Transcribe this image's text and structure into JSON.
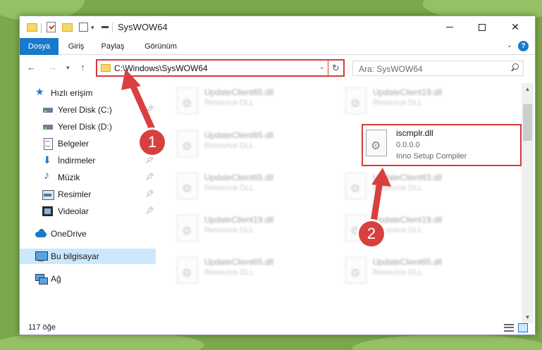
{
  "window": {
    "title": "SysWOW64",
    "minimize_glyph": "",
    "close_glyph": "✕"
  },
  "ribbon": {
    "tabs": [
      "Dosya",
      "Giriş",
      "Paylaş",
      "Görünüm"
    ],
    "help_glyph": "?"
  },
  "address_bar": {
    "path": "C:\\Windows\\SysWOW64",
    "search_placeholder": "Ara: SysWOW64"
  },
  "sidebar": {
    "items": [
      {
        "label": "Hızlı erişim",
        "icon": "star-icon",
        "pinned": false
      },
      {
        "label": "Yerel Disk (C:)",
        "icon": "disk-icon",
        "pinned": true
      },
      {
        "label": "Yerel Disk (D:)",
        "icon": "disk-icon",
        "pinned": true
      },
      {
        "label": "Belgeler",
        "icon": "document-icon",
        "pinned": true
      },
      {
        "label": "İndirmeler",
        "icon": "download-icon",
        "pinned": true
      },
      {
        "label": "Müzik",
        "icon": "music-icon",
        "pinned": true
      },
      {
        "label": "Resimler",
        "icon": "pictures-icon",
        "pinned": true
      },
      {
        "label": "Videolar",
        "icon": "video-icon",
        "pinned": true
      },
      {
        "label": "OneDrive",
        "icon": "onedrive-icon",
        "pinned": false
      },
      {
        "label": "Bu bilgisayar",
        "icon": "computer-icon",
        "pinned": false,
        "selected": true
      },
      {
        "label": "Ağ",
        "icon": "network-icon",
        "pinned": false
      }
    ]
  },
  "files": {
    "left_column": [
      {
        "name": "UpdateClient65.dll",
        "type": "Resource DLL"
      },
      {
        "name": "UpdateClient65.dll",
        "type": "Resource DLL"
      },
      {
        "name": "UpdateClient65.dll",
        "type": "Resource DLL"
      },
      {
        "name": "UpdateClient19.dll",
        "type": "Resource DLL"
      },
      {
        "name": "UpdateClient65.dll",
        "type": "Resource DLL"
      }
    ],
    "right_column": [
      {
        "name": "UpdateClient19.dll",
        "type": "Resource DLL"
      },
      {
        "name": "UpdateClient63.dll",
        "type": "Resource DLL"
      },
      {
        "name": "UpdateClient19.dll",
        "type": "Resource DLL"
      },
      {
        "name": "UpdateClient65.dll",
        "type": "Resource DLL"
      }
    ],
    "highlighted": {
      "name": "iscmplr.dll",
      "version": "0.0.0.0",
      "description": "Inno Setup Compiler"
    }
  },
  "status_bar": {
    "item_count": "117 öğe"
  },
  "annotations": {
    "callout_1": "1",
    "callout_2": "2",
    "highlight_color": "#d83a3a"
  }
}
